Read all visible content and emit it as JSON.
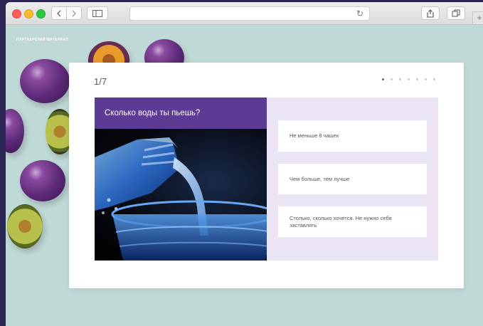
{
  "page": {
    "partner_label": "ПАРТНЕРСКИЙ МАТЕРИАЛ"
  },
  "quiz": {
    "progress": "1/7",
    "total_steps": 7,
    "current_step": 1,
    "question": "Сколько воды ты пьешь?",
    "answers": [
      "Не меньше 8 чашек",
      "Чем больше, тем лучше",
      "Столько, сколько хочется. Не нужно себя заставлять"
    ]
  },
  "browser": {
    "back_icon": "chevron-left-icon",
    "forward_icon": "chevron-right-icon",
    "reload_icon": "reload-icon",
    "share_icon": "share-icon",
    "tabs_icon": "tabs-icon"
  },
  "colors": {
    "background": "#bfd9d6",
    "question_header": "#5b3b93",
    "answers_panel": "#ebe4f4"
  }
}
